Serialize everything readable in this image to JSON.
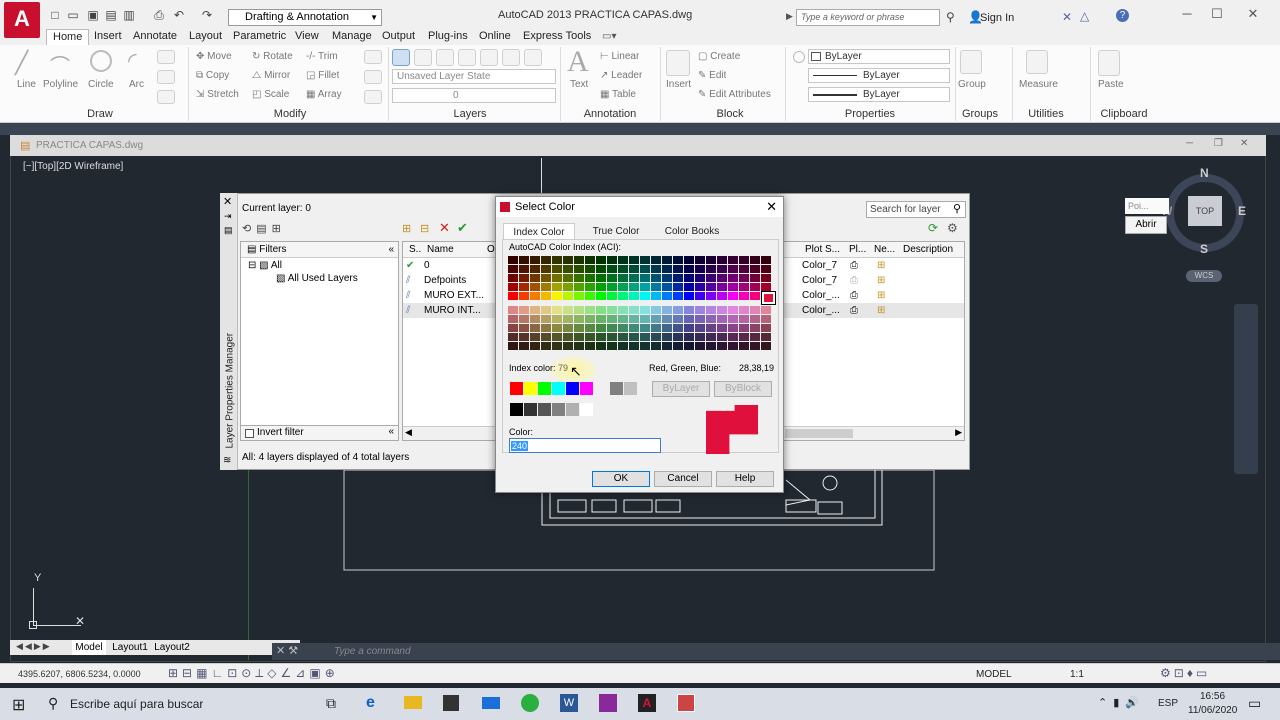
{
  "titlebar": {
    "workspace": "Drafting & Annotation",
    "title": "AutoCAD 2013    PRACTICA CAPAS.dwg",
    "search_placeholder": "Type a keyword or phrase",
    "signin": "Sign In"
  },
  "ribbon_tabs": [
    "Home",
    "Insert",
    "Annotate",
    "Layout",
    "Parametric",
    "View",
    "Manage",
    "Output",
    "Plug-ins",
    "Online",
    "Express Tools"
  ],
  "draw": {
    "line": "Line",
    "polyline": "Polyline",
    "circle": "Circle",
    "arc": "Arc",
    "title": "Draw"
  },
  "modify": {
    "move": "Move",
    "rotate": "Rotate",
    "trim": "Trim",
    "copy": "Copy",
    "mirror": "Mirror",
    "fillet": "Fillet",
    "stretch": "Stretch",
    "scale": "Scale",
    "array": "Array",
    "title": "Modify"
  },
  "layers": {
    "state": "Unsaved Layer State",
    "current": "0",
    "title": "Layers"
  },
  "annotation": {
    "text": "Text",
    "linear": "Linear",
    "leader": "Leader",
    "table": "Table",
    "title": "Annotation"
  },
  "block": {
    "insert": "Insert",
    "create": "Create",
    "edit": "Edit",
    "edit_attr": "Edit Attributes",
    "title": "Block"
  },
  "properties": {
    "color": "ByLayer",
    "linetype": "ByLayer",
    "lineweight": "ByLayer",
    "title": "Properties"
  },
  "groups": {
    "group": "Group",
    "title": "Groups"
  },
  "utilities": {
    "measure": "Measure",
    "title": "Utilities"
  },
  "clipboard": {
    "paste": "Paste",
    "title": "Clipboard"
  },
  "drawing": {
    "tab": "PRACTICA CAPAS.dwg",
    "view_label": "[−][Top][2D Wireframe]",
    "cube_top": "TOP",
    "n": "N",
    "s": "S",
    "e": "E",
    "w": "W",
    "wcs": "WCS",
    "abrir": "Abrir",
    "poi": "Poi...",
    "axis_y": "Y",
    "layout_tabs": [
      "Model",
      "Layout1",
      "Layout2"
    ]
  },
  "lpm": {
    "current": "Current layer: 0",
    "search": "Search for layer",
    "filters": "Filters",
    "tree": [
      "All",
      "All Used Layers"
    ],
    "invert": "Invert filter",
    "footer": "All: 4 layers displayed of 4 total layers",
    "side_title": "Layer Properties Manager",
    "cols": {
      "s": "S..",
      "name": "Name",
      "o": "O",
      "plot_style": "Plot S...",
      "pl": "Pl...",
      "ne": "Ne...",
      "desc": "Description"
    },
    "rows": [
      {
        "name": "0",
        "plot": "Color_7"
      },
      {
        "name": "Defpoints",
        "plot": "Color_7"
      },
      {
        "name": "MURO EXT...",
        "plot": "Color_..."
      },
      {
        "name": "MURO INT...",
        "plot": "Color_..."
      }
    ]
  },
  "dialog": {
    "title": "Select Color",
    "tabs": [
      "Index Color",
      "True Color",
      "Color Books"
    ],
    "aci_label": "AutoCAD Color Index (ACI):",
    "index_label": "Index color:",
    "index_value": "79",
    "rgb_label": "Red, Green, Blue:",
    "rgb_value": "28,38,19",
    "bylayer": "ByLayer",
    "byblock": "ByBlock",
    "color_label": "Color:",
    "color_value": "240",
    "ok": "OK",
    "cancel": "Cancel",
    "help": "Help",
    "selected_color": "#e0103c"
  },
  "command": {
    "placeholder": "Type  a  command"
  },
  "status": {
    "coords": "4395.6207, 6806.5234, 0.0000",
    "model": "MODEL",
    "scale": "1:1"
  },
  "taskbar": {
    "search": "Escribe aquí para buscar",
    "lang": "ESP",
    "time": "16:56",
    "date": "11/06/2020"
  }
}
